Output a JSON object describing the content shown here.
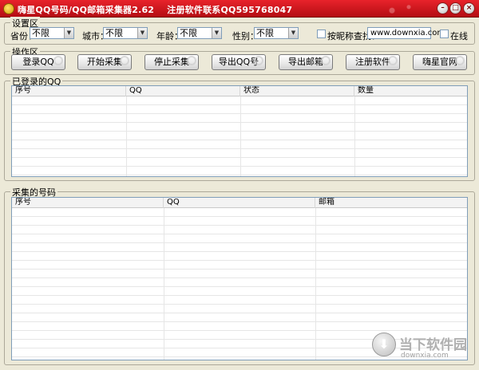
{
  "window": {
    "title": "嗨星QQ号码/QQ邮箱采集器2.62    注册软件联系QQ595768047",
    "min_icon": "minimize-icon",
    "max_icon": "maximize-icon",
    "close_icon": "close-icon"
  },
  "settings": {
    "group_title": "设置区",
    "province_label": "省份：",
    "province_value": "不限",
    "city_label": "城市：",
    "city_value": "不限",
    "age_label": "年龄：",
    "age_value": "不限",
    "gender_label": "性别：",
    "gender_value": "不限",
    "nickname_search_label": "按昵称查找：",
    "nickname_search_value": "www.downxia.com",
    "online_label": "在线"
  },
  "actions": {
    "group_title": "操作区",
    "buttons": [
      "登录QQ",
      "开始采集",
      "停止采集",
      "导出QQ号",
      "导出邮箱",
      "注册软件",
      "嗨星官网"
    ]
  },
  "logged_in": {
    "group_title": "已登录的QQ",
    "columns": [
      "序号",
      "QQ",
      "状态",
      "数量"
    ]
  },
  "collected": {
    "group_title": "采集的号码",
    "columns": [
      "序号",
      "QQ",
      "邮箱"
    ]
  },
  "watermark": {
    "text": "当下软件园",
    "url": "downxia.com"
  },
  "colors": {
    "titlebar": "#c8121a",
    "background": "#ece9d8"
  }
}
